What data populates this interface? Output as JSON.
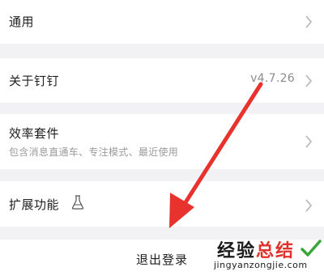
{
  "settings": {
    "general": {
      "label": "通用"
    },
    "about": {
      "label": "关于钉钉",
      "version": "v4.7.26"
    },
    "efficiency": {
      "label": "效率套件",
      "subtitle": "包含消息直通车、专注模式、最近使用"
    },
    "extensions": {
      "label": "扩展功能"
    },
    "logout": {
      "label": "退出登录"
    }
  },
  "watermark": {
    "title_part1": "经验",
    "title_part2": "总结",
    "url": "jingyanzongjie.com"
  },
  "icons": {
    "chevron": "chevron-right-icon",
    "flask": "flask-icon",
    "annotation": "red-arrow"
  },
  "colors": {
    "background": "#f2f2f4",
    "row_background": "#ffffff",
    "annotation_arrow": "#e8322e"
  }
}
